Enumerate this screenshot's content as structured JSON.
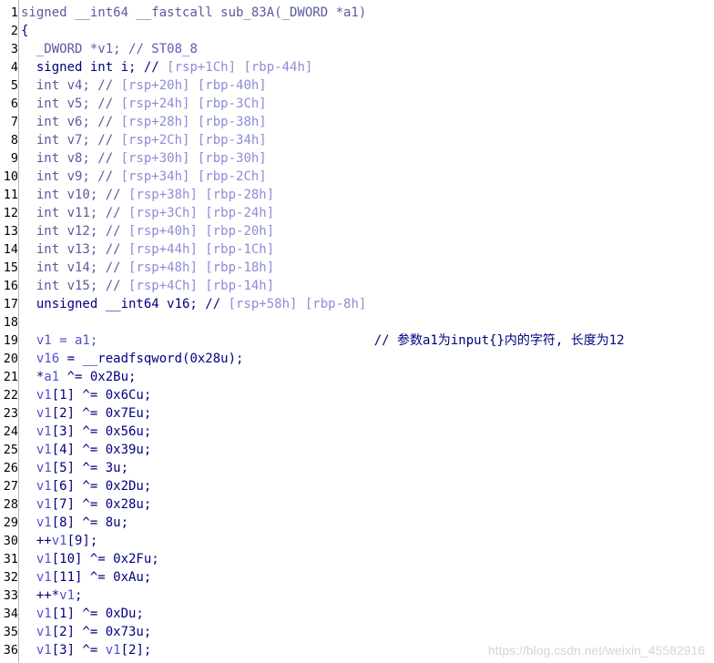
{
  "code_lines": [
    {
      "n": "1",
      "t": [
        {
          "c": "t-hdr",
          "v": "signed __int64 __fastcall sub_83A(_DWORD *a1)"
        }
      ]
    },
    {
      "n": "2",
      "t": [
        {
          "c": "t-op",
          "v": "{"
        }
      ]
    },
    {
      "n": "3",
      "t": [
        {
          "c": "t-ind",
          "v": "  "
        },
        {
          "c": "t-gray",
          "v": "_DWORD *v1; "
        },
        {
          "c": "t-cm",
          "v": "// ST08_8"
        }
      ]
    },
    {
      "n": "4",
      "t": [
        {
          "c": "t-ind",
          "v": "  "
        },
        {
          "c": "t-kw",
          "v": "signed int i; // "
        },
        {
          "c": "t-addr",
          "v": "[rsp+1Ch] [rbp-44h]"
        }
      ]
    },
    {
      "n": "5",
      "t": [
        {
          "c": "t-ind",
          "v": "  "
        },
        {
          "c": "t-gray",
          "v": "int v4; // "
        },
        {
          "c": "t-addr",
          "v": "[rsp+20h] [rbp-40h]"
        }
      ]
    },
    {
      "n": "6",
      "t": [
        {
          "c": "t-ind",
          "v": "  "
        },
        {
          "c": "t-gray",
          "v": "int v5; // "
        },
        {
          "c": "t-addr",
          "v": "[rsp+24h] [rbp-3Ch]"
        }
      ]
    },
    {
      "n": "7",
      "t": [
        {
          "c": "t-ind",
          "v": "  "
        },
        {
          "c": "t-gray",
          "v": "int v6; // "
        },
        {
          "c": "t-addr",
          "v": "[rsp+28h] [rbp-38h]"
        }
      ]
    },
    {
      "n": "8",
      "t": [
        {
          "c": "t-ind",
          "v": "  "
        },
        {
          "c": "t-gray",
          "v": "int v7; // "
        },
        {
          "c": "t-addr",
          "v": "[rsp+2Ch] [rbp-34h]"
        }
      ]
    },
    {
      "n": "9",
      "t": [
        {
          "c": "t-ind",
          "v": "  "
        },
        {
          "c": "t-gray",
          "v": "int v8; // "
        },
        {
          "c": "t-addr",
          "v": "[rsp+30h] [rbp-30h]"
        }
      ]
    },
    {
      "n": "10",
      "t": [
        {
          "c": "t-ind",
          "v": "  "
        },
        {
          "c": "t-gray",
          "v": "int v9; // "
        },
        {
          "c": "t-addr",
          "v": "[rsp+34h] [rbp-2Ch]"
        }
      ]
    },
    {
      "n": "11",
      "t": [
        {
          "c": "t-ind",
          "v": "  "
        },
        {
          "c": "t-gray",
          "v": "int v10; // "
        },
        {
          "c": "t-addr",
          "v": "[rsp+38h] [rbp-28h]"
        }
      ]
    },
    {
      "n": "12",
      "t": [
        {
          "c": "t-ind",
          "v": "  "
        },
        {
          "c": "t-gray",
          "v": "int v11; // "
        },
        {
          "c": "t-addr",
          "v": "[rsp+3Ch] [rbp-24h]"
        }
      ]
    },
    {
      "n": "13",
      "t": [
        {
          "c": "t-ind",
          "v": "  "
        },
        {
          "c": "t-gray",
          "v": "int v12; // "
        },
        {
          "c": "t-addr",
          "v": "[rsp+40h] [rbp-20h]"
        }
      ]
    },
    {
      "n": "14",
      "t": [
        {
          "c": "t-ind",
          "v": "  "
        },
        {
          "c": "t-gray",
          "v": "int v13; // "
        },
        {
          "c": "t-addr",
          "v": "[rsp+44h] [rbp-1Ch]"
        }
      ]
    },
    {
      "n": "15",
      "t": [
        {
          "c": "t-ind",
          "v": "  "
        },
        {
          "c": "t-gray",
          "v": "int v14; // "
        },
        {
          "c": "t-addr",
          "v": "[rsp+48h] [rbp-18h]"
        }
      ]
    },
    {
      "n": "16",
      "t": [
        {
          "c": "t-ind",
          "v": "  "
        },
        {
          "c": "t-gray",
          "v": "int v15; // "
        },
        {
          "c": "t-addr",
          "v": "[rsp+4Ch] [rbp-14h]"
        }
      ]
    },
    {
      "n": "17",
      "t": [
        {
          "c": "t-ind",
          "v": "  "
        },
        {
          "c": "t-kw",
          "v": "unsigned __int64 v16; // "
        },
        {
          "c": "t-addr",
          "v": "[rsp+58h] [rbp-8h]"
        }
      ]
    },
    {
      "n": "18",
      "t": []
    },
    {
      "n": "19",
      "t": [
        {
          "c": "t-ind",
          "v": "  "
        },
        {
          "c": "t-id",
          "v": "v1 = a1;"
        },
        {
          "c": "t-ind",
          "v": "                                    "
        },
        {
          "c": "t-kw",
          "v": "// 参数a1为input{}内的字符, 长度为12"
        }
      ]
    },
    {
      "n": "20",
      "t": [
        {
          "c": "t-ind",
          "v": "  "
        },
        {
          "c": "t-id",
          "v": "v16"
        },
        {
          "c": "t-fn",
          "v": " = __readfsqword(0x28u);"
        }
      ]
    },
    {
      "n": "21",
      "t": [
        {
          "c": "t-ind",
          "v": "  "
        },
        {
          "c": "t-op",
          "v": "*"
        },
        {
          "c": "t-id",
          "v": "a1"
        },
        {
          "c": "t-num",
          "v": " ^= 0x2Bu;"
        }
      ]
    },
    {
      "n": "22",
      "t": [
        {
          "c": "t-ind",
          "v": "  "
        },
        {
          "c": "t-id",
          "v": "v1"
        },
        {
          "c": "t-num",
          "v": "[1] ^= 0x6Cu;"
        }
      ]
    },
    {
      "n": "23",
      "t": [
        {
          "c": "t-ind",
          "v": "  "
        },
        {
          "c": "t-id",
          "v": "v1"
        },
        {
          "c": "t-num",
          "v": "[2] ^= 0x7Eu;"
        }
      ]
    },
    {
      "n": "24",
      "t": [
        {
          "c": "t-ind",
          "v": "  "
        },
        {
          "c": "t-id",
          "v": "v1"
        },
        {
          "c": "t-num",
          "v": "[3] ^= 0x56u;"
        }
      ]
    },
    {
      "n": "25",
      "t": [
        {
          "c": "t-ind",
          "v": "  "
        },
        {
          "c": "t-id",
          "v": "v1"
        },
        {
          "c": "t-num",
          "v": "[4] ^= 0x39u;"
        }
      ]
    },
    {
      "n": "26",
      "t": [
        {
          "c": "t-ind",
          "v": "  "
        },
        {
          "c": "t-id",
          "v": "v1"
        },
        {
          "c": "t-num",
          "v": "[5] ^= 3u;"
        }
      ]
    },
    {
      "n": "27",
      "t": [
        {
          "c": "t-ind",
          "v": "  "
        },
        {
          "c": "t-id",
          "v": "v1"
        },
        {
          "c": "t-num",
          "v": "[6] ^= 0x2Du;"
        }
      ]
    },
    {
      "n": "28",
      "t": [
        {
          "c": "t-ind",
          "v": "  "
        },
        {
          "c": "t-id",
          "v": "v1"
        },
        {
          "c": "t-num",
          "v": "[7] ^= 0x28u;"
        }
      ]
    },
    {
      "n": "29",
      "t": [
        {
          "c": "t-ind",
          "v": "  "
        },
        {
          "c": "t-id",
          "v": "v1"
        },
        {
          "c": "t-num",
          "v": "[8] ^= 8u;"
        }
      ]
    },
    {
      "n": "30",
      "t": [
        {
          "c": "t-ind",
          "v": "  "
        },
        {
          "c": "t-op",
          "v": "++"
        },
        {
          "c": "t-id",
          "v": "v1"
        },
        {
          "c": "t-num",
          "v": "[9];"
        }
      ]
    },
    {
      "n": "31",
      "t": [
        {
          "c": "t-ind",
          "v": "  "
        },
        {
          "c": "t-id",
          "v": "v1"
        },
        {
          "c": "t-num",
          "v": "[10] ^= 0x2Fu;"
        }
      ]
    },
    {
      "n": "32",
      "t": [
        {
          "c": "t-ind",
          "v": "  "
        },
        {
          "c": "t-id",
          "v": "v1"
        },
        {
          "c": "t-num",
          "v": "[11] ^= 0xAu;"
        }
      ]
    },
    {
      "n": "33",
      "t": [
        {
          "c": "t-ind",
          "v": "  "
        },
        {
          "c": "t-op",
          "v": "++*"
        },
        {
          "c": "t-id",
          "v": "v1"
        },
        {
          "c": "t-num",
          "v": ";"
        }
      ]
    },
    {
      "n": "34",
      "t": [
        {
          "c": "t-ind",
          "v": "  "
        },
        {
          "c": "t-id",
          "v": "v1"
        },
        {
          "c": "t-num",
          "v": "[1] ^= 0xDu;"
        }
      ]
    },
    {
      "n": "35",
      "t": [
        {
          "c": "t-ind",
          "v": "  "
        },
        {
          "c": "t-id",
          "v": "v1"
        },
        {
          "c": "t-num",
          "v": "[2] ^= 0x73u;"
        }
      ]
    },
    {
      "n": "36",
      "t": [
        {
          "c": "t-ind",
          "v": "  "
        },
        {
          "c": "t-id",
          "v": "v1"
        },
        {
          "c": "t-num",
          "v": "[3] ^= "
        },
        {
          "c": "t-id",
          "v": "v1"
        },
        {
          "c": "t-num",
          "v": "[2];"
        }
      ]
    }
  ],
  "watermark": "https://blog.csdn.net/weixin_45582916"
}
